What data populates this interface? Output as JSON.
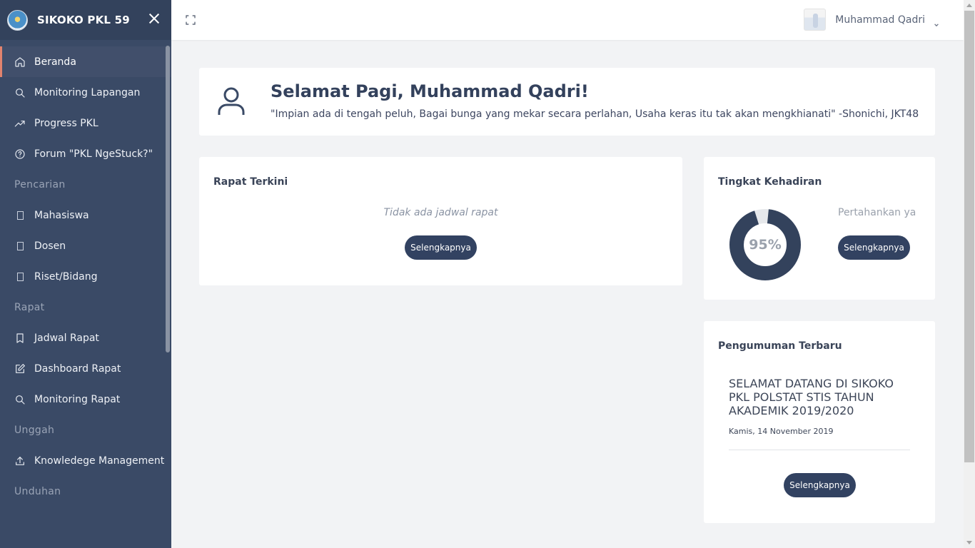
{
  "app": {
    "title": "SIKOKO PKL 59"
  },
  "sidebar": {
    "items": [
      {
        "label": "Beranda",
        "icon": "home-icon",
        "active": true
      },
      {
        "label": "Monitoring Lapangan",
        "icon": "search-icon"
      },
      {
        "label": "Progress PKL",
        "icon": "trending-up-icon"
      },
      {
        "label": "Forum \"PKL NgeStuck?\"",
        "icon": "help-circle-icon"
      }
    ],
    "section_pencarian": "Pencarian",
    "pencarian_items": [
      {
        "label": "Mahasiswa",
        "icon": "missing-glyph-icon"
      },
      {
        "label": "Dosen",
        "icon": "missing-glyph-icon"
      },
      {
        "label": "Riset/Bidang",
        "icon": "missing-glyph-icon"
      }
    ],
    "section_rapat": "Rapat",
    "rapat_items": [
      {
        "label": "Jadwal Rapat",
        "icon": "bookmark-icon"
      },
      {
        "label": "Dashboard Rapat",
        "icon": "edit-icon"
      },
      {
        "label": "Monitoring Rapat",
        "icon": "search-icon"
      }
    ],
    "section_unggah": "Unggah",
    "unggah_items": [
      {
        "label": "Knowledege Management",
        "icon": "upload-icon"
      }
    ],
    "section_unduhan": "Unduhan"
  },
  "topbar": {
    "user_name": "Muhammad Qadri"
  },
  "welcome": {
    "greeting": "Selamat Pagi, Muhammad Qadri!",
    "quote": "\"Impian ada di tengah peluh, Bagai bunga yang mekar secara perlahan, Usaha keras itu tak akan mengkhianati\" -Shonichi, JKT48"
  },
  "rapat_terkini": {
    "title": "Rapat Terkini",
    "empty_message": "Tidak ada jadwal rapat",
    "button": "Selengkapnya"
  },
  "kehadiran": {
    "title": "Tingkat Kehadiran",
    "percent_label": "95%",
    "percent_value": 0.95,
    "note": "Pertahankan ya",
    "button": "Selengkapnya",
    "ring_color": "#33425c",
    "track_color": "#e6e8eb"
  },
  "pengumuman": {
    "title": "Pengumuman Terbaru",
    "item_title": "SELAMAT DATANG DI SIKOKO PKL POLSTAT STIS TAHUN AKADEMIK 2019/2020",
    "item_date": "Kamis, 14 November 2019",
    "button": "Selengkapnya"
  }
}
